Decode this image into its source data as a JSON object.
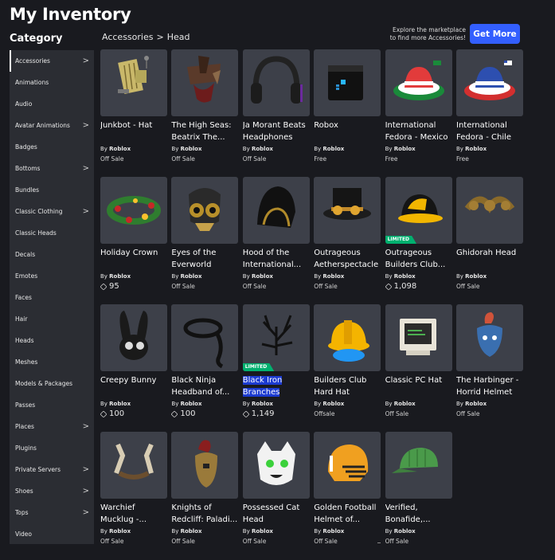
{
  "page": {
    "title": "My Inventory",
    "category_heading": "Category"
  },
  "breadcrumb": {
    "root": "Accessories",
    "separator": ">",
    "current": "Head"
  },
  "promo": {
    "line1": "Explore the marketplace",
    "line2": "to find more Accessories!",
    "button_label": "Get More",
    "button_color": "#335fff"
  },
  "categories": [
    {
      "label": "Accessories",
      "has_submenu": true,
      "selected": true
    },
    {
      "label": "Animations",
      "has_submenu": false
    },
    {
      "label": "Audio",
      "has_submenu": false
    },
    {
      "label": "Avatar Animations",
      "has_submenu": true
    },
    {
      "label": "Badges",
      "has_submenu": false
    },
    {
      "label": "Bottoms",
      "has_submenu": true
    },
    {
      "label": "Bundles",
      "has_submenu": false
    },
    {
      "label": "Classic Clothing",
      "has_submenu": true
    },
    {
      "label": "Classic Heads",
      "has_submenu": false
    },
    {
      "label": "Decals",
      "has_submenu": false
    },
    {
      "label": "Emotes",
      "has_submenu": false
    },
    {
      "label": "Faces",
      "has_submenu": false
    },
    {
      "label": "Hair",
      "has_submenu": false
    },
    {
      "label": "Heads",
      "has_submenu": false
    },
    {
      "label": "Meshes",
      "has_submenu": false
    },
    {
      "label": "Models & Packages",
      "has_submenu": false
    },
    {
      "label": "Passes",
      "has_submenu": false
    },
    {
      "label": "Places",
      "has_submenu": true
    },
    {
      "label": "Plugins",
      "has_submenu": false
    },
    {
      "label": "Private Servers",
      "has_submenu": true
    },
    {
      "label": "Shoes",
      "has_submenu": true
    },
    {
      "label": "Tops",
      "has_submenu": true
    },
    {
      "label": "Video",
      "has_submenu": false
    }
  ],
  "chevron_glyph": ">",
  "items": [
    {
      "name": "Junkbot - Hat",
      "creator_prefix": "By",
      "creator": "Roblox",
      "price": "Off Sale",
      "icon": "junkbot-hat-icon",
      "limited": false,
      "robux": false
    },
    {
      "name": "The High Seas: Beatrix The...",
      "creator_prefix": "By",
      "creator": "Roblox",
      "price": "Off Sale",
      "icon": "pirate-hat-icon",
      "limited": false,
      "robux": false
    },
    {
      "name": "Ja Morant Beats Headphones",
      "creator_prefix": "By",
      "creator": "Roblox",
      "price": "Off Sale",
      "icon": "headphones-icon",
      "limited": false,
      "robux": false
    },
    {
      "name": "Robox",
      "creator_prefix": "By",
      "creator": "Roblox",
      "price": "Free",
      "icon": "robox-head-icon",
      "limited": false,
      "robux": false
    },
    {
      "name": "International Fedora - Mexico",
      "creator_prefix": "By",
      "creator": "Roblox",
      "price": "Free",
      "icon": "fedora-mexico-icon",
      "limited": false,
      "robux": false
    },
    {
      "name": "International Fedora - Chile",
      "creator_prefix": "By",
      "creator": "Roblox",
      "price": "Free",
      "icon": "fedora-chile-icon",
      "limited": false,
      "robux": false
    },
    {
      "name": "Holiday Crown",
      "creator_prefix": "By",
      "creator": "Roblox",
      "price": "95",
      "icon": "holiday-crown-icon",
      "limited": false,
      "robux": true
    },
    {
      "name": "Eyes of the Everworld",
      "creator_prefix": "By",
      "creator": "Roblox",
      "price": "Off Sale",
      "icon": "eyes-everworld-icon",
      "limited": false,
      "robux": false
    },
    {
      "name": "Hood of the International...",
      "creator_prefix": "By",
      "creator": "Roblox",
      "price": "Off Sale",
      "icon": "hood-icon",
      "limited": false,
      "robux": false
    },
    {
      "name": "Outrageous Aetherspectacles",
      "creator_prefix": "By",
      "creator": "Roblox",
      "price": "Off Sale",
      "icon": "top-hat-goggles-icon",
      "limited": false,
      "robux": false
    },
    {
      "name": "Outrageous Builders Club...",
      "creator_prefix": "By",
      "creator": "Roblox",
      "price": "1,098",
      "icon": "builders-club-hat-icon",
      "limited": true,
      "limited_label": "LIMITED",
      "robux": true
    },
    {
      "name": "Ghidorah Head",
      "creator_prefix": "By",
      "creator": "Roblox",
      "price": "Off Sale",
      "icon": "dragon-head-icon",
      "limited": false,
      "robux": false
    },
    {
      "name": "Creepy Bunny",
      "creator_prefix": "By",
      "creator": "Roblox",
      "price": "100",
      "icon": "bunny-mask-icon",
      "limited": false,
      "robux": true
    },
    {
      "name": "Black Ninja Headband of...",
      "creator_prefix": "By",
      "creator": "Roblox",
      "price": "100",
      "icon": "headband-icon",
      "limited": false,
      "robux": true
    },
    {
      "name": "Black Iron Branches",
      "creator_prefix": "By",
      "creator": "Roblox",
      "price": "1,149",
      "icon": "iron-branches-icon",
      "limited": true,
      "limited_label": "LIMITED",
      "robux": true,
      "highlighted": true
    },
    {
      "name": "Builders Club Hard Hat",
      "creator_prefix": "By",
      "creator": "Roblox",
      "price": "Offsale",
      "icon": "hard-hat-icon",
      "limited": false,
      "robux": false
    },
    {
      "name": "Classic PC Hat",
      "creator_prefix": "By",
      "creator": "Roblox",
      "price": "Off Sale",
      "icon": "pc-hat-icon",
      "limited": false,
      "robux": false
    },
    {
      "name": "The Harbinger - Horrid Helmet",
      "creator_prefix": "By",
      "creator": "Roblox",
      "price": "Off Sale",
      "icon": "harbinger-helmet-icon",
      "limited": false,
      "robux": false
    },
    {
      "name": "Warchief Mucklug -...",
      "creator_prefix": "By",
      "creator": "Roblox",
      "price": "Off Sale",
      "icon": "horns-icon",
      "limited": false,
      "robux": false
    },
    {
      "name": "Knights of Redcliff: Paladi...",
      "creator_prefix": "By",
      "creator": "Roblox",
      "price": "Off Sale",
      "icon": "paladin-helmet-icon",
      "limited": false,
      "robux": false
    },
    {
      "name": "Possessed Cat Head",
      "creator_prefix": "By",
      "creator": "Roblox",
      "price": "Off Sale",
      "icon": "cat-head-icon",
      "limited": false,
      "robux": false
    },
    {
      "name": "Golden Football Helmet of...",
      "creator_prefix": "By",
      "creator": "Roblox",
      "price": "Off Sale",
      "icon": "football-helmet-icon",
      "limited": false,
      "robux": false
    },
    {
      "name": "Verified, Bonafide,...",
      "creator_prefix": "By",
      "creator": "Roblox",
      "price": "Off Sale",
      "icon": "green-cap-icon",
      "limited": false,
      "robux": false
    }
  ]
}
